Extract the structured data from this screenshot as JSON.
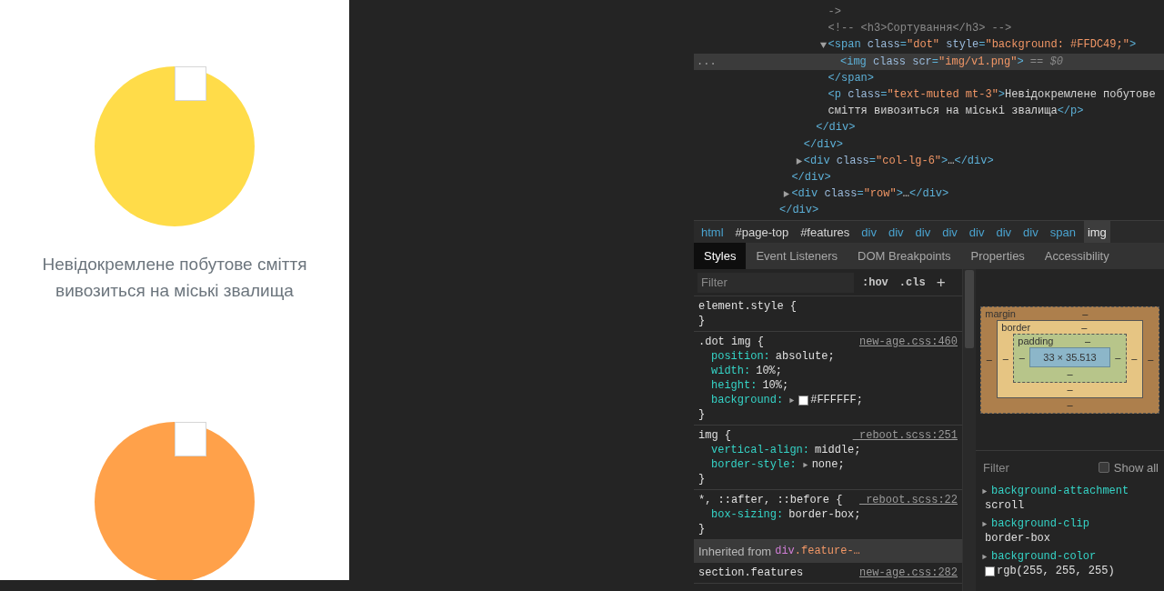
{
  "page": {
    "features": [
      {
        "color": "#ffdc49",
        "caption": "Невідокремлене побутове сміття вивозиться на міські звалища"
      },
      {
        "color": "#ffa14a"
      }
    ]
  },
  "devtools": {
    "elements_tree": [
      {
        "children": [
          {
            "children": [
              {
                "children": [
                  {
                    "children": [
                      {
                        "tokens": [
                          {
                            "kind": "comment",
                            "text": "->"
                          }
                        ],
                        "selected": false
                      },
                      {
                        "tokens": [
                          {
                            "kind": "comment",
                            "text": "<!-- <h3>Сортування</h3> -->"
                          }
                        ],
                        "selected": false
                      },
                      {
                        "tokens": [
                          {
                            "kind": "tag",
                            "text": "<span"
                          },
                          {
                            "kind": "attr",
                            "text": " class"
                          },
                          {
                            "kind": "tag",
                            "text": "="
                          },
                          {
                            "kind": "value",
                            "text": "\"dot\""
                          },
                          {
                            "kind": "attr",
                            "text": " style"
                          },
                          {
                            "kind": "tag",
                            "text": "="
                          },
                          {
                            "kind": "value",
                            "text": "\"background: #FFDC49;\""
                          },
                          {
                            "kind": "tag",
                            "text": ">"
                          }
                        ],
                        "expanded": true,
                        "selected": false,
                        "children": [
                          {
                            "tokens": [
                              {
                                "kind": "tag",
                                "text": "<img"
                              },
                              {
                                "kind": "attr",
                                "text": " class scr"
                              },
                              {
                                "kind": "tag",
                                "text": "="
                              },
                              {
                                "kind": "value",
                                "text": "\"img/v1.png\""
                              },
                              {
                                "kind": "tag",
                                "text": ">"
                              },
                              {
                                "kind": "marker",
                                "text": " == $0"
                              }
                            ],
                            "selected": true,
                            "gutter": "..."
                          }
                        ]
                      },
                      {
                        "tokens": [
                          {
                            "kind": "tag",
                            "text": "</span>"
                          }
                        ],
                        "selected": false
                      },
                      {
                        "tokens": [
                          {
                            "kind": "tag",
                            "text": "<p"
                          },
                          {
                            "kind": "attr",
                            "text": " class"
                          },
                          {
                            "kind": "tag",
                            "text": "="
                          },
                          {
                            "kind": "value",
                            "text": "\"text-muted mt-3\""
                          },
                          {
                            "kind": "tag",
                            "text": ">"
                          },
                          {
                            "kind": "text",
                            "text": "Невідокремлене побутове сміття вивозиться на міські звалища"
                          },
                          {
                            "kind": "tag",
                            "text": "</p>"
                          }
                        ],
                        "selected": false
                      }
                    ]
                  },
                  {
                    "tokens": [
                      {
                        "kind": "tag",
                        "text": "</div>"
                      }
                    ],
                    "selected": false
                  }
                ]
              },
              {
                "tokens": [
                  {
                    "kind": "tag",
                    "text": "</div>"
                  }
                ],
                "selected": false
              },
              {
                "tokens": [
                  {
                    "kind": "tag",
                    "text": "<div"
                  },
                  {
                    "kind": "attr",
                    "text": " class"
                  },
                  {
                    "kind": "tag",
                    "text": "="
                  },
                  {
                    "kind": "value",
                    "text": "\"col-lg-6\""
                  },
                  {
                    "kind": "tag",
                    "text": ">"
                  },
                  {
                    "kind": "text",
                    "text": "…"
                  },
                  {
                    "kind": "tag",
                    "text": "</div>"
                  }
                ],
                "expanded": false,
                "selected": false
              }
            ]
          },
          {
            "tokens": [
              {
                "kind": "tag",
                "text": "</div>"
              }
            ],
            "selected": false
          },
          {
            "tokens": [
              {
                "kind": "tag",
                "text": "<div"
              },
              {
                "kind": "attr",
                "text": " class"
              },
              {
                "kind": "tag",
                "text": "="
              },
              {
                "kind": "value",
                "text": "\"row\""
              },
              {
                "kind": "tag",
                "text": ">"
              },
              {
                "kind": "text",
                "text": "…"
              },
              {
                "kind": "tag",
                "text": "</div>"
              }
            ],
            "expanded": false,
            "selected": false
          }
        ]
      },
      {
        "tokens": [
          {
            "kind": "tag",
            "text": "</div>"
          }
        ],
        "selected": false
      }
    ],
    "breadcrumb": [
      {
        "kind": "tag",
        "text": "html",
        "selected": false
      },
      {
        "kind": "id",
        "text": "#page-top",
        "selected": false
      },
      {
        "kind": "id",
        "text": "#features",
        "selected": false
      },
      {
        "kind": "tag",
        "text": "div",
        "selected": false
      },
      {
        "kind": "tag",
        "text": "div",
        "selected": false
      },
      {
        "kind": "tag",
        "text": "div",
        "selected": false
      },
      {
        "kind": "tag",
        "text": "div",
        "selected": false
      },
      {
        "kind": "tag",
        "text": "div",
        "selected": false
      },
      {
        "kind": "tag",
        "text": "div",
        "selected": false
      },
      {
        "kind": "tag",
        "text": "div",
        "selected": false
      },
      {
        "kind": "tag",
        "text": "span",
        "selected": false
      },
      {
        "kind": "tag",
        "text": "img",
        "selected": true
      }
    ],
    "tabs": [
      {
        "label": "Styles",
        "selected": true
      },
      {
        "label": "Event Listeners",
        "selected": false
      },
      {
        "label": "DOM Breakpoints",
        "selected": false
      },
      {
        "label": "Properties",
        "selected": false
      },
      {
        "label": "Accessibility",
        "selected": false
      }
    ],
    "styles": {
      "filter": {
        "placeholder": "Filter"
      },
      "hov": ":hov",
      "cls": ".cls",
      "add": "+",
      "rules": [
        {
          "selector": "element.style {",
          "close": "}"
        },
        {
          "selector": ".dot img {",
          "source": "new-age.css:460",
          "close": "}",
          "declarations": [
            {
              "property": "position:",
              "value": "absolute;"
            },
            {
              "property": "width:",
              "value": "10%;"
            },
            {
              "property": "height:",
              "value": "10%;"
            },
            {
              "property": "background:",
              "value": "#FFFFFF;",
              "expandable": true,
              "color": "#ffffff"
            }
          ]
        },
        {
          "selector": "img {",
          "source": "_reboot.scss:251",
          "close": "}",
          "declarations": [
            {
              "property": "vertical-align:",
              "value": "middle;"
            },
            {
              "property": "border-style:",
              "value": "none;",
              "expandable": true
            }
          ]
        },
        {
          "selector": "*, ::after, ::before {",
          "source": "_reboot.scss:22",
          "close": "}",
          "declarations": [
            {
              "property": "box-sizing:",
              "value": "border-box;"
            }
          ]
        }
      ],
      "inherited": {
        "label": "Inherited from",
        "element": "div",
        "class": ".feature-…"
      },
      "rules_after": [
        {
          "selector": "section.features",
          "source": "new-age.css:282"
        }
      ]
    },
    "box_model": {
      "margin": {
        "label": "margin",
        "top": "–",
        "right": "–",
        "bottom": "–",
        "left": "–"
      },
      "border": {
        "label": "border",
        "top": "–",
        "right": "–",
        "bottom": "–",
        "left": "–"
      },
      "padding": {
        "label": "padding",
        "top": "–",
        "right": "–",
        "bottom": "–",
        "left": "–"
      },
      "content": "33 × 35.513"
    },
    "computed": {
      "filter": {
        "placeholder": "Filter"
      },
      "show_all": {
        "label": "Show all",
        "checked": false
      },
      "properties": [
        {
          "name": "background-attachment",
          "value": "scroll"
        },
        {
          "name": "background-clip",
          "value": "border-box"
        },
        {
          "name": "background-color",
          "value": "rgb(255, 255, 255)",
          "color": "#ffffff"
        }
      ]
    }
  }
}
